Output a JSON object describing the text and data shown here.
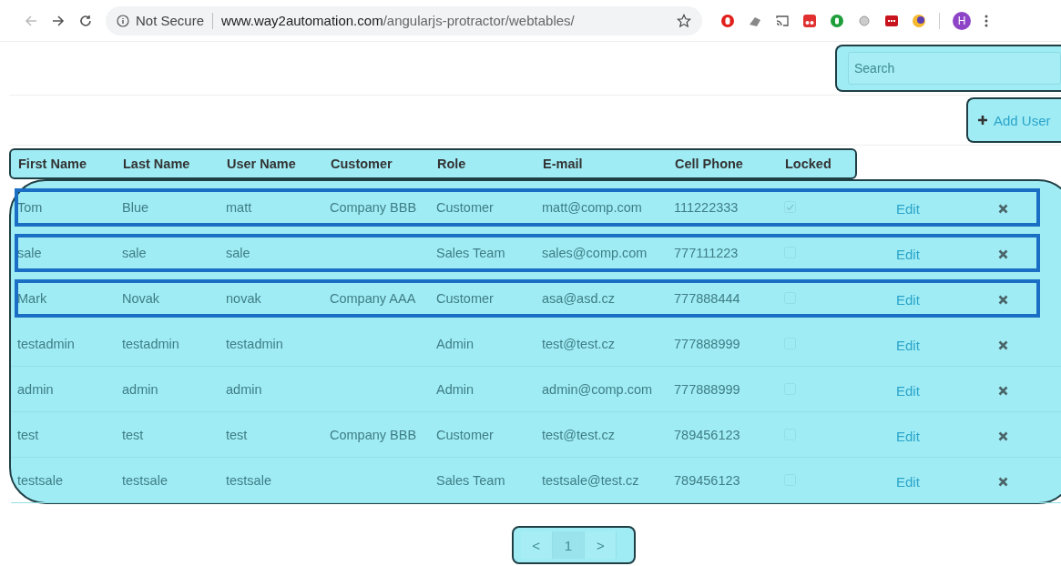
{
  "browser": {
    "security": "Not Secure",
    "url_host": "www.way2automation.com",
    "url_path": "/angularjs-protractor/webtables/",
    "profile_initial": "H"
  },
  "search": {
    "placeholder": "Search"
  },
  "add_user": {
    "label": "Add User"
  },
  "table": {
    "columns": [
      "First Name",
      "Last Name",
      "User Name",
      "Customer",
      "Role",
      "E-mail",
      "Cell Phone",
      "Locked"
    ],
    "rows": [
      {
        "cells": [
          "Tom",
          "Blue",
          "matt",
          "Company BBB",
          "Customer",
          "matt@comp.com",
          "111222333"
        ],
        "locked": true,
        "outlined": true,
        "edit": "Edit"
      },
      {
        "cells": [
          "sale",
          "sale",
          "sale",
          "",
          "Sales Team",
          "sales@comp.com",
          "777111223"
        ],
        "locked": false,
        "outlined": true,
        "edit": "Edit"
      },
      {
        "cells": [
          "Mark",
          "Novak",
          "novak",
          "Company AAA",
          "Customer",
          "asa@asd.cz",
          "777888444"
        ],
        "locked": false,
        "outlined": true,
        "edit": "Edit"
      },
      {
        "cells": [
          "testadmin",
          "testadmin",
          "testadmin",
          "",
          "Admin",
          "test@test.cz",
          "777888999"
        ],
        "locked": false,
        "outlined": false,
        "edit": "Edit"
      },
      {
        "cells": [
          "admin",
          "admin",
          "admin",
          "",
          "Admin",
          "admin@comp.com",
          "777888999"
        ],
        "locked": false,
        "outlined": false,
        "edit": "Edit"
      },
      {
        "cells": [
          "test",
          "test",
          "test",
          "Company BBB",
          "Customer",
          "test@test.cz",
          "789456123"
        ],
        "locked": false,
        "outlined": false,
        "edit": "Edit"
      },
      {
        "cells": [
          "testsale",
          "testsale",
          "testsale",
          "",
          "Sales Team",
          "testsale@test.cz",
          "789456123"
        ],
        "locked": false,
        "outlined": false,
        "edit": "Edit"
      }
    ]
  },
  "pagination": {
    "prev": "<",
    "page": "1",
    "next": ">"
  }
}
